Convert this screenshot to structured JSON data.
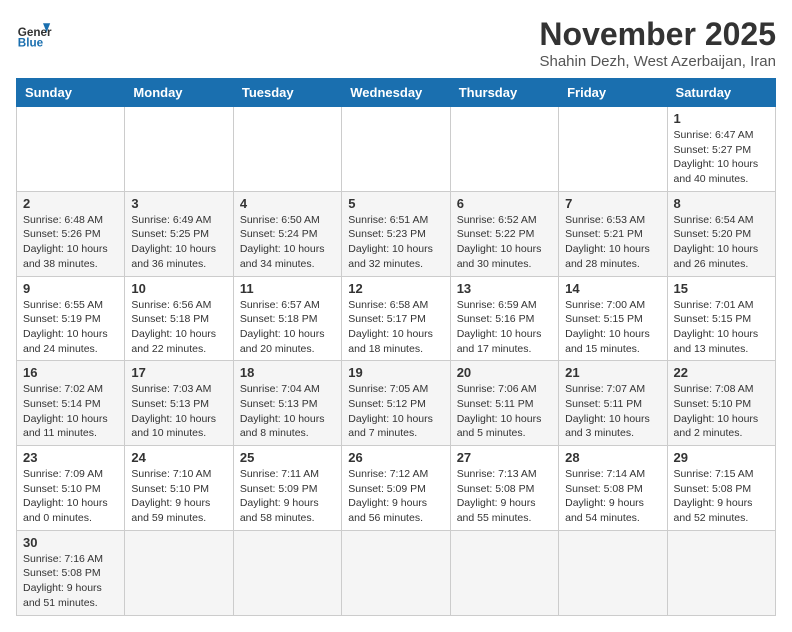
{
  "header": {
    "logo_general": "General",
    "logo_blue": "Blue",
    "month_title": "November 2025",
    "subtitle": "Shahin Dezh, West Azerbaijan, Iran"
  },
  "weekdays": [
    "Sunday",
    "Monday",
    "Tuesday",
    "Wednesday",
    "Thursday",
    "Friday",
    "Saturday"
  ],
  "weeks": [
    [
      {
        "day": "",
        "info": ""
      },
      {
        "day": "",
        "info": ""
      },
      {
        "day": "",
        "info": ""
      },
      {
        "day": "",
        "info": ""
      },
      {
        "day": "",
        "info": ""
      },
      {
        "day": "",
        "info": ""
      },
      {
        "day": "1",
        "info": "Sunrise: 6:47 AM\nSunset: 5:27 PM\nDaylight: 10 hours and 40 minutes."
      }
    ],
    [
      {
        "day": "2",
        "info": "Sunrise: 6:48 AM\nSunset: 5:26 PM\nDaylight: 10 hours and 38 minutes."
      },
      {
        "day": "3",
        "info": "Sunrise: 6:49 AM\nSunset: 5:25 PM\nDaylight: 10 hours and 36 minutes."
      },
      {
        "day": "4",
        "info": "Sunrise: 6:50 AM\nSunset: 5:24 PM\nDaylight: 10 hours and 34 minutes."
      },
      {
        "day": "5",
        "info": "Sunrise: 6:51 AM\nSunset: 5:23 PM\nDaylight: 10 hours and 32 minutes."
      },
      {
        "day": "6",
        "info": "Sunrise: 6:52 AM\nSunset: 5:22 PM\nDaylight: 10 hours and 30 minutes."
      },
      {
        "day": "7",
        "info": "Sunrise: 6:53 AM\nSunset: 5:21 PM\nDaylight: 10 hours and 28 minutes."
      },
      {
        "day": "8",
        "info": "Sunrise: 6:54 AM\nSunset: 5:20 PM\nDaylight: 10 hours and 26 minutes."
      }
    ],
    [
      {
        "day": "9",
        "info": "Sunrise: 6:55 AM\nSunset: 5:19 PM\nDaylight: 10 hours and 24 minutes."
      },
      {
        "day": "10",
        "info": "Sunrise: 6:56 AM\nSunset: 5:18 PM\nDaylight: 10 hours and 22 minutes."
      },
      {
        "day": "11",
        "info": "Sunrise: 6:57 AM\nSunset: 5:18 PM\nDaylight: 10 hours and 20 minutes."
      },
      {
        "day": "12",
        "info": "Sunrise: 6:58 AM\nSunset: 5:17 PM\nDaylight: 10 hours and 18 minutes."
      },
      {
        "day": "13",
        "info": "Sunrise: 6:59 AM\nSunset: 5:16 PM\nDaylight: 10 hours and 17 minutes."
      },
      {
        "day": "14",
        "info": "Sunrise: 7:00 AM\nSunset: 5:15 PM\nDaylight: 10 hours and 15 minutes."
      },
      {
        "day": "15",
        "info": "Sunrise: 7:01 AM\nSunset: 5:15 PM\nDaylight: 10 hours and 13 minutes."
      }
    ],
    [
      {
        "day": "16",
        "info": "Sunrise: 7:02 AM\nSunset: 5:14 PM\nDaylight: 10 hours and 11 minutes."
      },
      {
        "day": "17",
        "info": "Sunrise: 7:03 AM\nSunset: 5:13 PM\nDaylight: 10 hours and 10 minutes."
      },
      {
        "day": "18",
        "info": "Sunrise: 7:04 AM\nSunset: 5:13 PM\nDaylight: 10 hours and 8 minutes."
      },
      {
        "day": "19",
        "info": "Sunrise: 7:05 AM\nSunset: 5:12 PM\nDaylight: 10 hours and 7 minutes."
      },
      {
        "day": "20",
        "info": "Sunrise: 7:06 AM\nSunset: 5:11 PM\nDaylight: 10 hours and 5 minutes."
      },
      {
        "day": "21",
        "info": "Sunrise: 7:07 AM\nSunset: 5:11 PM\nDaylight: 10 hours and 3 minutes."
      },
      {
        "day": "22",
        "info": "Sunrise: 7:08 AM\nSunset: 5:10 PM\nDaylight: 10 hours and 2 minutes."
      }
    ],
    [
      {
        "day": "23",
        "info": "Sunrise: 7:09 AM\nSunset: 5:10 PM\nDaylight: 10 hours and 0 minutes."
      },
      {
        "day": "24",
        "info": "Sunrise: 7:10 AM\nSunset: 5:10 PM\nDaylight: 9 hours and 59 minutes."
      },
      {
        "day": "25",
        "info": "Sunrise: 7:11 AM\nSunset: 5:09 PM\nDaylight: 9 hours and 58 minutes."
      },
      {
        "day": "26",
        "info": "Sunrise: 7:12 AM\nSunset: 5:09 PM\nDaylight: 9 hours and 56 minutes."
      },
      {
        "day": "27",
        "info": "Sunrise: 7:13 AM\nSunset: 5:08 PM\nDaylight: 9 hours and 55 minutes."
      },
      {
        "day": "28",
        "info": "Sunrise: 7:14 AM\nSunset: 5:08 PM\nDaylight: 9 hours and 54 minutes."
      },
      {
        "day": "29",
        "info": "Sunrise: 7:15 AM\nSunset: 5:08 PM\nDaylight: 9 hours and 52 minutes."
      }
    ],
    [
      {
        "day": "30",
        "info": "Sunrise: 7:16 AM\nSunset: 5:08 PM\nDaylight: 9 hours and 51 minutes."
      },
      {
        "day": "",
        "info": ""
      },
      {
        "day": "",
        "info": ""
      },
      {
        "day": "",
        "info": ""
      },
      {
        "day": "",
        "info": ""
      },
      {
        "day": "",
        "info": ""
      },
      {
        "day": "",
        "info": ""
      }
    ]
  ]
}
